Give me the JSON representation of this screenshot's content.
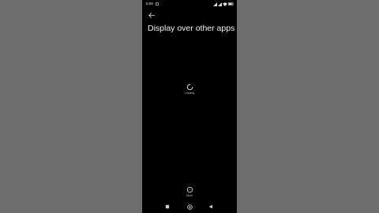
{
  "status_bar": {
    "time": "5:59",
    "notification_icon": "notification-icon",
    "icons": [
      "signal-icon",
      "signal-icon",
      "wifi-icon",
      "battery-icon"
    ]
  },
  "header": {
    "back_icon": "arrow-left-icon",
    "title": "Display over other apps"
  },
  "content": {
    "loading_label": "Loading"
  },
  "footer": {
    "more_label": "More"
  },
  "nav_bar": {
    "items": [
      "recents-icon",
      "home-icon",
      "back-icon"
    ]
  },
  "colors": {
    "background": "#6e6e6e",
    "screen": "#000000",
    "text": "#f0f0f0"
  }
}
